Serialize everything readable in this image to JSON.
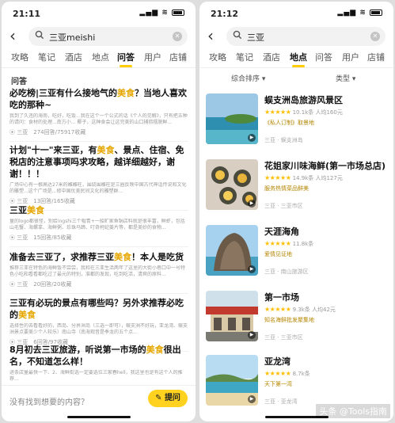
{
  "left": {
    "time": "21:11",
    "query": "三亚meishi",
    "tabs": [
      "攻略",
      "笔记",
      "酒店",
      "地点",
      "问答",
      "用户",
      "店铺"
    ],
    "active_tab": 4,
    "section": "问答",
    "qas": [
      {
        "pre": "必吃榜|三亚有什么接地气的",
        "hl": "美食",
        "post": "？当地人喜欢吃的那种~",
        "snip": "我到了久违的海南，吃好，吃饭...我在这个一个公式的话《个人的见解》，只有把五种的请问：食材的处理...南方小... 椰子，这种食会让这完美的山口捕捞摆脱鲜...",
        "meta": "三亚　274回答/75917收藏"
      },
      {
        "pre": "计划\"十一\"来三亚，有",
        "hl": "美食",
        "post": "、景点、住宿、免税店的注意事项吗求攻略，越详细越好，谢谢！！！",
        "snip": "广场中心有一根高达27米的雕雕柱，围绕围雕柱是三圈反映中国古代神话传说和文化的雕塑...这个广场是...修中国优美民间文化的雕塑群...",
        "meta": "三亚　13回答/165收藏"
      },
      {
        "pre": "三亚",
        "hl": "美食",
        "post": "",
        "snip": "量的logo都很怪，别给ingshi三个帽青+一船旷家鱼锅店料就是很丰富，鲜虾，包括山毛蟹、海螺拿、海鲜粥、珍珠马蹄、叮奇柯妃姜片等，都是美妙的食物...",
        "meta": "三亚　15回答/85收藏"
      },
      {
        "pre": "准备去三亚了，求推荐三亚",
        "hl": "美食",
        "post": "！本人是吃货",
        "snip": "推荐三亚在特色的海鲜饭不尝尝，我和在三亚生活两年了这里的大街小巷口中一号特色小吃和看看都吃过了最元的特别，准都的发现，吃到吃活，清爽的原料...",
        "meta": "三亚　20回答/20收藏"
      },
      {
        "pre": "三亚有必玩的景点有哪些吗？另外求推荐必吃的",
        "hl": "美食",
        "post": "",
        "snip": "选择性的去看看好的，西岛、分界洲岛（三选一即可），蜈支洲不好玩，亚龙湾、蜈支洲景点要美少个人较乐）南山寺（南海观音是季龙的五个点...",
        "meta": "三亚　6回答/97收藏"
      },
      {
        "pre": "8月初去三亚旅游，听说第一市场的",
        "hl": "美食",
        "post": "很出名，不知道怎么样！",
        "snip": "进条店量最快一下、2、海鲜街选一定要选位三家春hell，我这里也是有这个人的推荐...",
        "meta": ""
      }
    ],
    "ask_prompt": "没有找到想要的内容？",
    "ask_button": "提问"
  },
  "right": {
    "time": "21:12",
    "query": "三亚",
    "tabs": [
      "攻略",
      "笔记",
      "酒店",
      "地点",
      "问答",
      "用户",
      "店铺"
    ],
    "active_tab": 3,
    "filter_sort": "综合排序",
    "filter_type": "类型",
    "places": [
      {
        "name": "蜈支洲岛旅游风景区",
        "rating": "10.1k条 人均160元",
        "tag": "《私人订制》取景地",
        "area": "三亚 · 蜈支洲岛",
        "thumb": "beach"
      },
      {
        "name": "花姐家川味海鲜(第一市场总店)",
        "rating": "14.9k条 人均127元",
        "tag": "服务热情菜品鲜美",
        "area": "三亚 · 三亚市区",
        "thumb": "food"
      },
      {
        "name": "天涯海角",
        "rating": "11.8k条",
        "tag": "爱情见证地",
        "area": "三亚 · 南山旅游区",
        "thumb": "rock"
      },
      {
        "name": "第一市场",
        "rating": "9.3k条 人均42元",
        "tag": "知名海鲜批发聚集地",
        "area": "三亚 · 三亚市区",
        "thumb": "market"
      },
      {
        "name": "亚龙湾",
        "rating": "8.7k条",
        "tag": "天下第一湾",
        "area": "三亚 · 亚龙湾",
        "thumb": "bay"
      }
    ],
    "watermark": "头条 @Tools指南"
  }
}
